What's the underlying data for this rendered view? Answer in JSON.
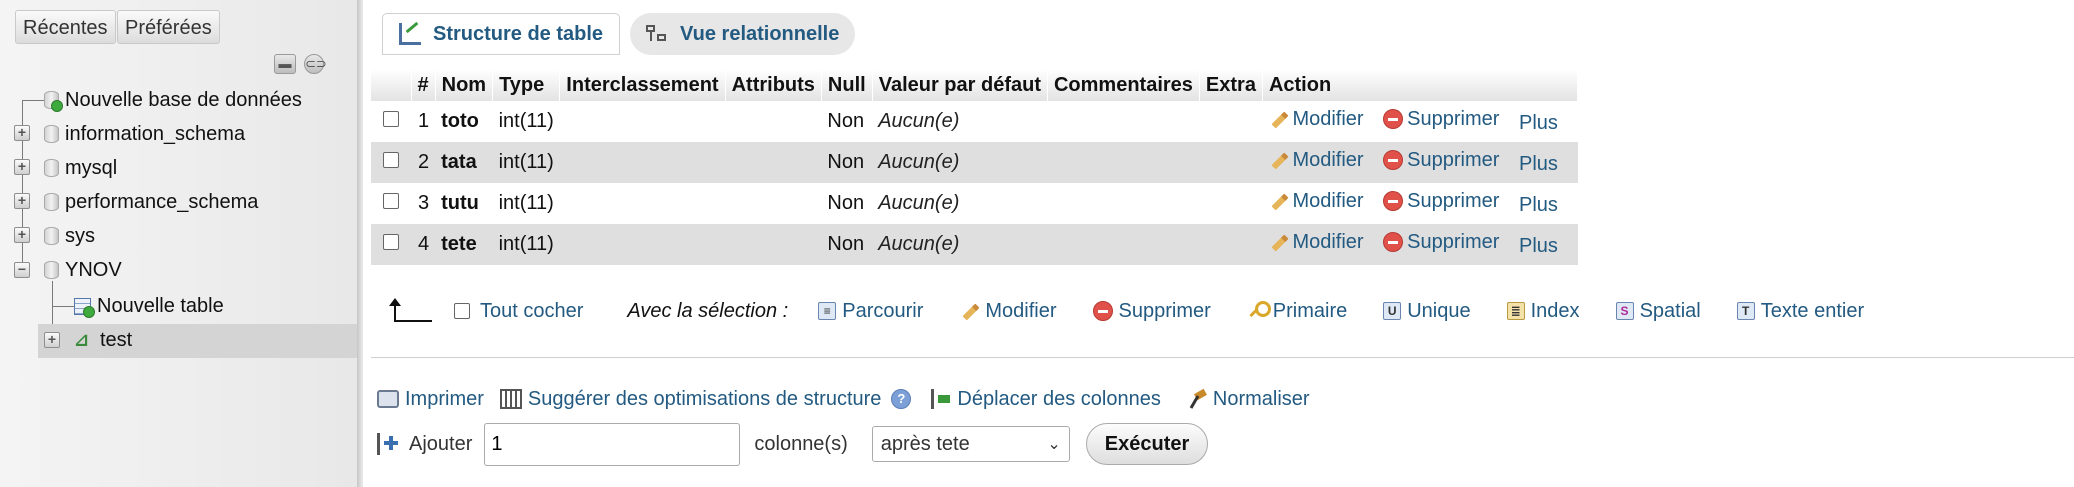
{
  "sidebar": {
    "tabs": [
      "Récentes",
      "Préférées"
    ],
    "tree": [
      {
        "label": "Nouvelle base de données",
        "kind": "new-db"
      },
      {
        "label": "information_schema",
        "kind": "db"
      },
      {
        "label": "mysql",
        "kind": "db"
      },
      {
        "label": "performance_schema",
        "kind": "db"
      },
      {
        "label": "sys",
        "kind": "db"
      },
      {
        "label": "YNOV",
        "kind": "db-open"
      },
      {
        "label": "Nouvelle table",
        "kind": "new-table"
      },
      {
        "label": "test",
        "kind": "table-selected"
      }
    ]
  },
  "tabs": {
    "structure": "Structure de table",
    "relational": "Vue relationnelle"
  },
  "table": {
    "headers": [
      "#",
      "Nom",
      "Type",
      "Interclassement",
      "Attributs",
      "Null",
      "Valeur par défaut",
      "Commentaires",
      "Extra",
      "Action"
    ],
    "rows": [
      {
        "num": "1",
        "name": "toto",
        "type": "int(11)",
        "null": "Non",
        "default": "Aucun(e)"
      },
      {
        "num": "2",
        "name": "tata",
        "type": "int(11)",
        "null": "Non",
        "default": "Aucun(e)"
      },
      {
        "num": "3",
        "name": "tutu",
        "type": "int(11)",
        "null": "Non",
        "default": "Aucun(e)"
      },
      {
        "num": "4",
        "name": "tete",
        "type": "int(11)",
        "null": "Non",
        "default": "Aucun(e)"
      }
    ],
    "actions": {
      "modify": "Modifier",
      "delete": "Supprimer",
      "more": "Plus"
    }
  },
  "bulk": {
    "check_all": "Tout cocher",
    "with_selection": "Avec la sélection :",
    "actions": [
      "Parcourir",
      "Modifier",
      "Supprimer",
      "Primaire",
      "Unique",
      "Index",
      "Spatial",
      "Texte entier"
    ]
  },
  "tools": {
    "print": "Imprimer",
    "suggest": "Suggérer des optimisations de structure",
    "move_columns": "Déplacer des colonnes",
    "normalize": "Normaliser"
  },
  "add_columns": {
    "label": "Ajouter",
    "count": "1",
    "unit": "colonne(s)",
    "position": "après tete",
    "execute": "Exécuter"
  }
}
